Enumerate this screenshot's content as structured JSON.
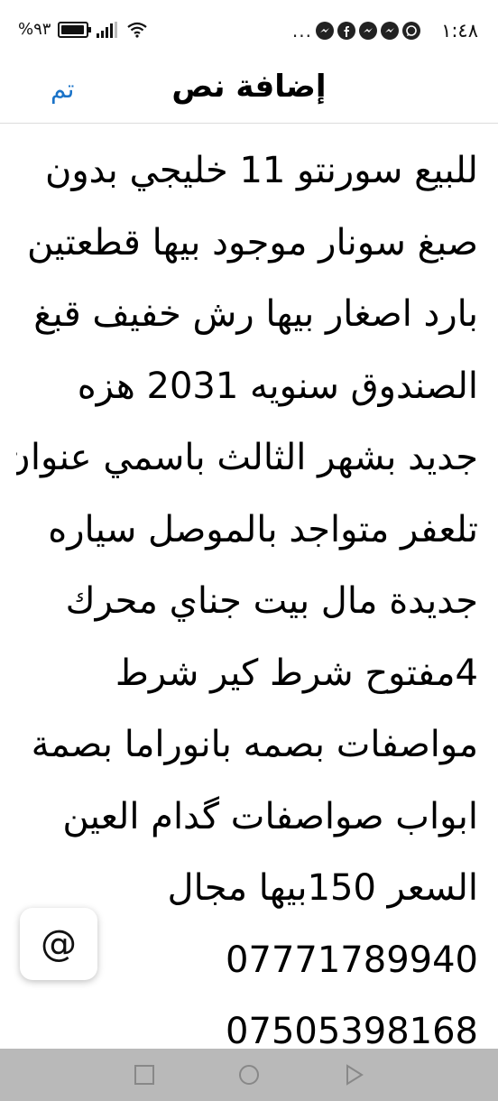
{
  "status_bar": {
    "time": "١:٤٨",
    "battery": "%٩٣",
    "more": "...",
    "app_icons": [
      "whatsapp-icon",
      "messenger-icon",
      "messenger-icon",
      "facebook-icon",
      "messenger-icon"
    ],
    "battery_level": 0.93
  },
  "header": {
    "title": "إضافة نص",
    "done_label": "تم"
  },
  "editor": {
    "lines": [
      "للبيع سورنتو 11 خليجي بدون",
      "صبغ سونار موجود بيها قطعتين",
      "بارد اصغار بيها رش خفيف قبغ",
      "الصندوق سنويه 2031 هزه",
      "جديد بشهر الثالث باسمي عنوان",
      "تلعفر متواجد بالموصل سياره",
      "جديدة مال بيت جناي محرك",
      "4مفتوح شرط كير شرط",
      "مواصفات بصمه بانوراما بصمة",
      "ابواب صواصفات گدام العين",
      "السعر 150بيها مجال",
      "07771789940",
      "07505398168"
    ]
  },
  "mention_button": {
    "label": "@"
  },
  "colors": {
    "accent": "#1a73c8",
    "nav_bar": "#b9b9b9"
  }
}
